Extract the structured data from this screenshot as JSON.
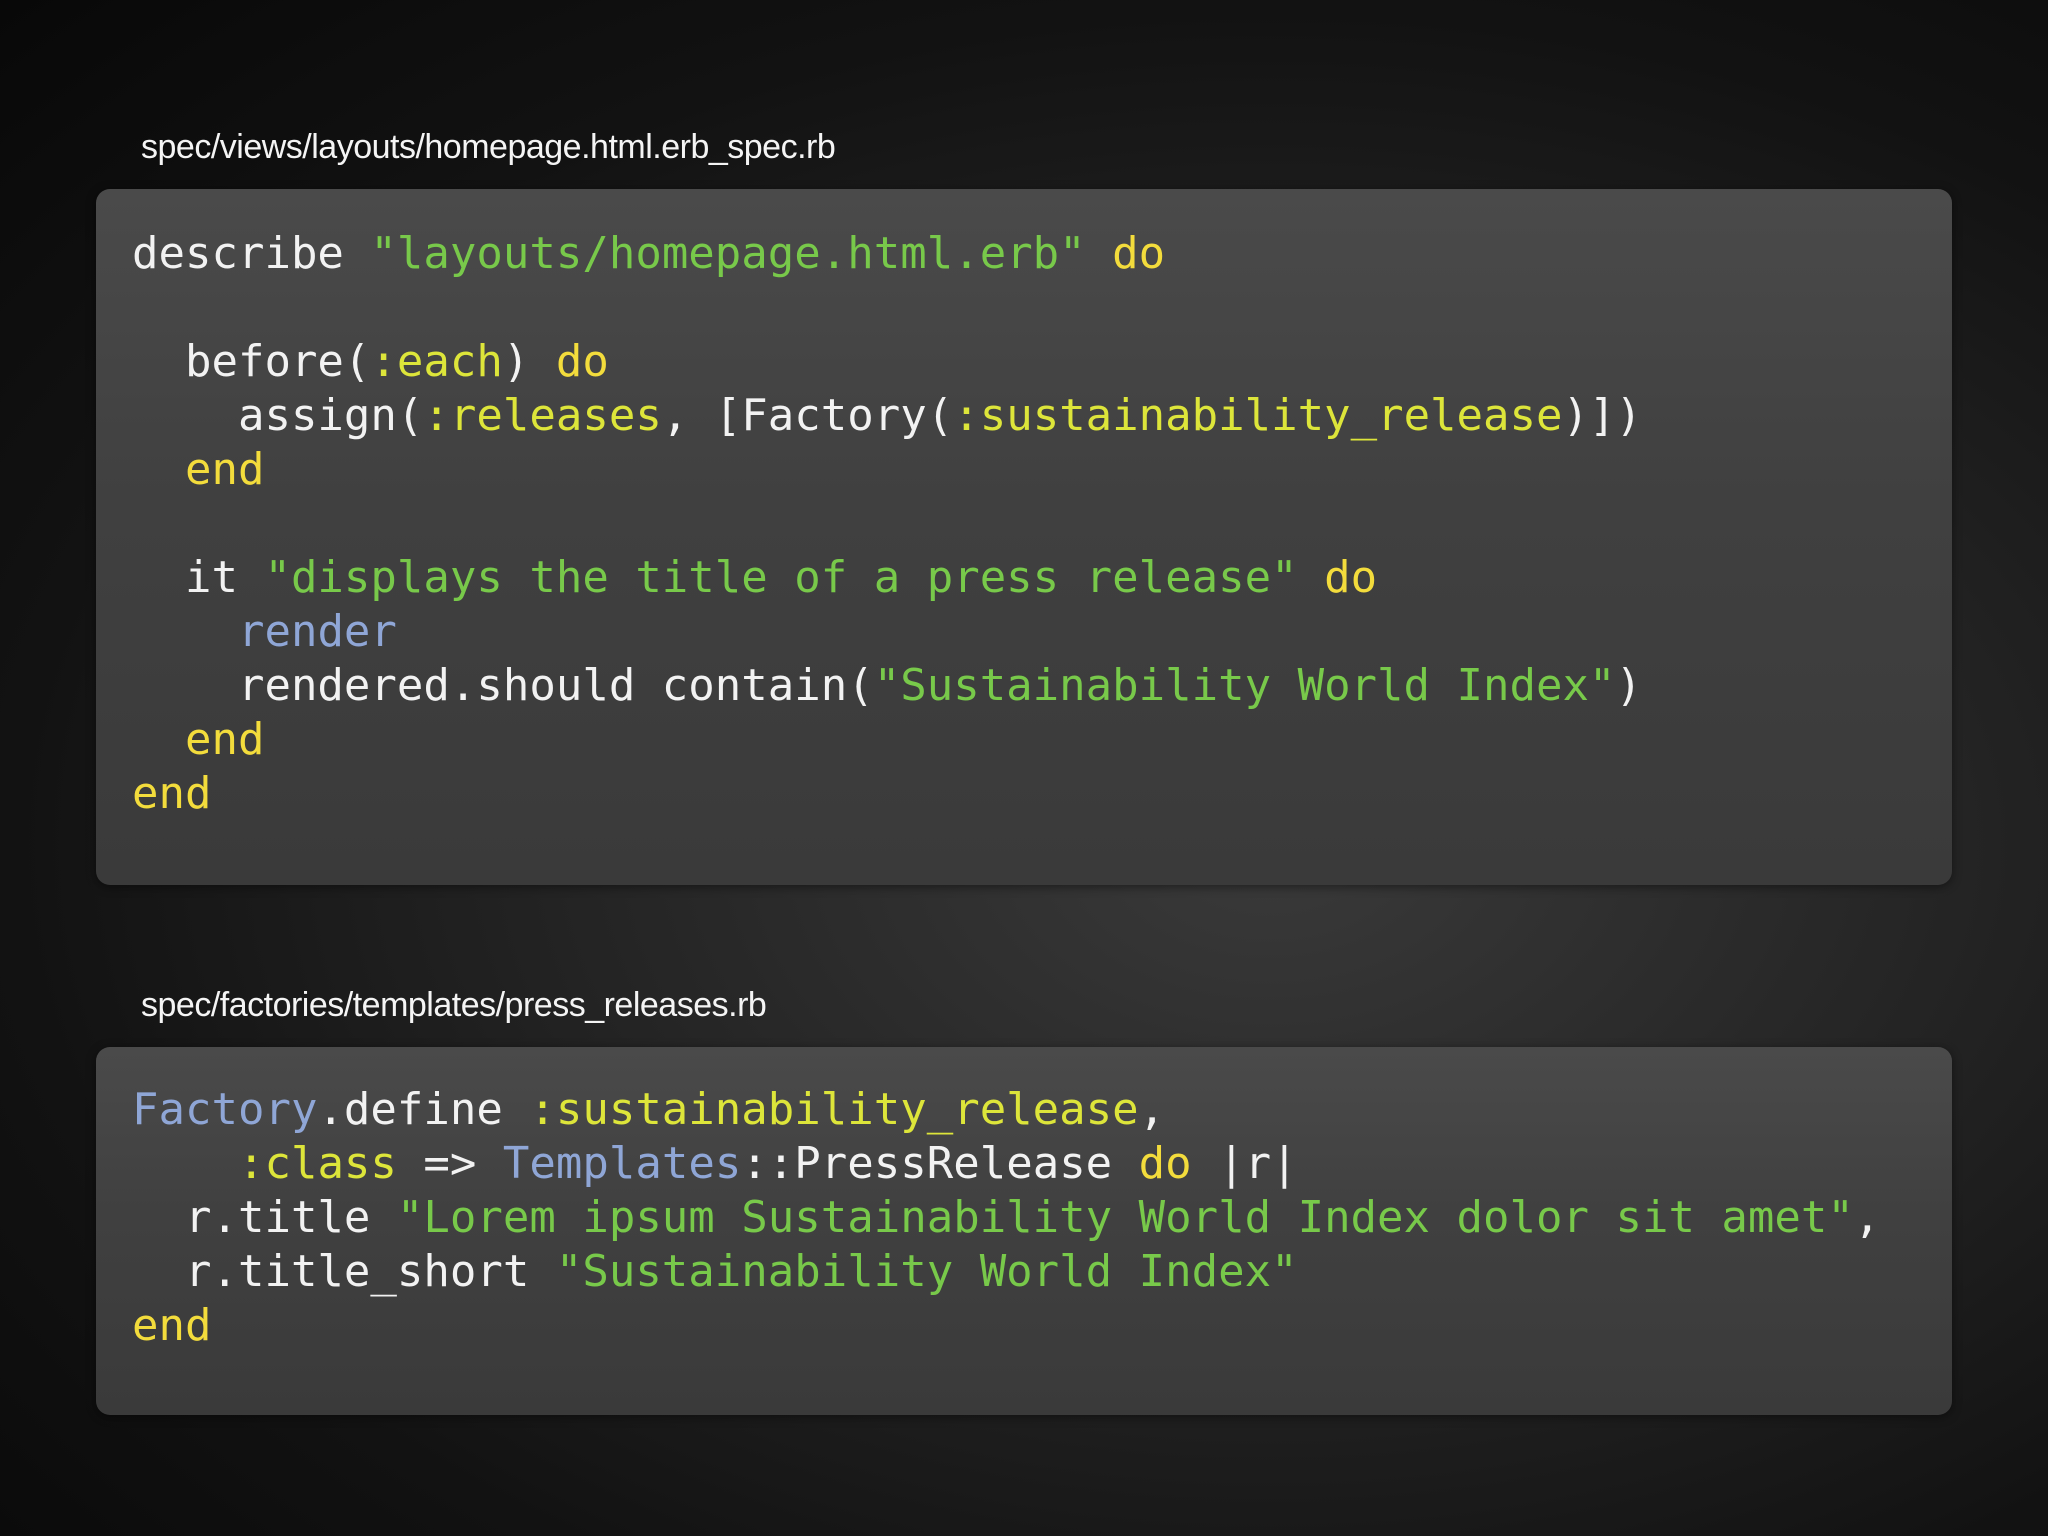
{
  "slide": {
    "file1": {
      "name": "spec/views/layouts/homepage.html.erb_spec.rb",
      "lines": [
        [
          {
            "t": "describe ",
            "c": "text"
          },
          {
            "t": "\"layouts/homepage.html.erb\"",
            "c": "str"
          },
          {
            "t": " ",
            "c": "text"
          },
          {
            "t": "do",
            "c": "kw"
          }
        ],
        [],
        [
          {
            "t": "  before(",
            "c": "text"
          },
          {
            "t": ":each",
            "c": "sym"
          },
          {
            "t": ") ",
            "c": "text"
          },
          {
            "t": "do",
            "c": "kw"
          }
        ],
        [
          {
            "t": "    assign(",
            "c": "text"
          },
          {
            "t": ":releases",
            "c": "sym"
          },
          {
            "t": ", [Factory(",
            "c": "text"
          },
          {
            "t": ":sustainability_release",
            "c": "sym"
          },
          {
            "t": ")])",
            "c": "text"
          }
        ],
        [
          {
            "t": "  ",
            "c": "text"
          },
          {
            "t": "end",
            "c": "kw"
          }
        ],
        [],
        [
          {
            "t": "  it ",
            "c": "text"
          },
          {
            "t": "\"displays the title of a press release\"",
            "c": "str"
          },
          {
            "t": " ",
            "c": "text"
          },
          {
            "t": "do",
            "c": "kw"
          }
        ],
        [
          {
            "t": "    ",
            "c": "text"
          },
          {
            "t": "render",
            "c": "call"
          }
        ],
        [
          {
            "t": "    rendered.should contain(",
            "c": "text"
          },
          {
            "t": "\"Sustainability World Index\"",
            "c": "str"
          },
          {
            "t": ")",
            "c": "text"
          }
        ],
        [
          {
            "t": "  ",
            "c": "text"
          },
          {
            "t": "end",
            "c": "kw"
          }
        ],
        [
          {
            "t": "end",
            "c": "kw"
          }
        ]
      ]
    },
    "file2": {
      "name": "spec/factories/templates/press_releases.rb",
      "lines": [
        [
          {
            "t": "Factory",
            "c": "call"
          },
          {
            "t": ".define ",
            "c": "text"
          },
          {
            "t": ":sustainability_release",
            "c": "sym"
          },
          {
            "t": ",",
            "c": "text"
          }
        ],
        [
          {
            "t": "    ",
            "c": "text"
          },
          {
            "t": ":class",
            "c": "sym"
          },
          {
            "t": " => ",
            "c": "text"
          },
          {
            "t": "Templates",
            "c": "call"
          },
          {
            "t": "::PressRelease ",
            "c": "text"
          },
          {
            "t": "do",
            "c": "kw"
          },
          {
            "t": " |r|",
            "c": "text"
          }
        ],
        [
          {
            "t": "  r.title ",
            "c": "text"
          },
          {
            "t": "\"Lorem ipsum Sustainability World Index dolor sit amet\"",
            "c": "str"
          },
          {
            "t": ",",
            "c": "text"
          }
        ],
        [
          {
            "t": "  r.title_short ",
            "c": "text"
          },
          {
            "t": "\"Sustainability World Index\"",
            "c": "str"
          }
        ],
        [
          {
            "t": "end",
            "c": "kw"
          }
        ]
      ]
    },
    "colors": {
      "keyword": "#f3dc3c",
      "symbol": "#dde53a",
      "string": "#78c94a",
      "constant": "#8fa6d6",
      "text": "#f2f2f2",
      "panel": "#444444"
    }
  }
}
